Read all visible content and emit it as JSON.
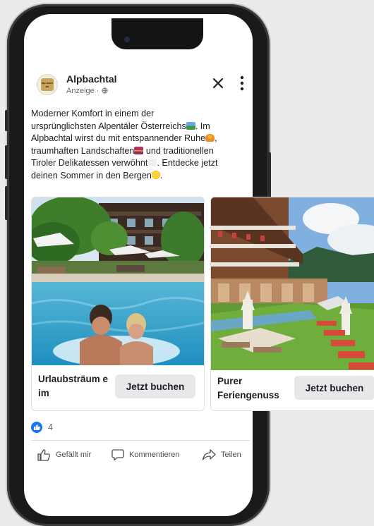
{
  "post": {
    "page_name": "Alpbachtal",
    "sponsored": "Anzeige · ",
    "logo_text": "alp bach tal",
    "text": {
      "l1": "Moderner Komfort in einem der",
      "l2": "ursprünglichsten Alpentäler Österreichs",
      "l2b": ". Im",
      "l3": "Alpbachtal wirst du mit entspannender Ruhe",
      "l3b": ",",
      "l4": "traumhaften Landschaften",
      "l4b": " und traditionellen",
      "l5": "Tiroler Delikatessen verwöhnt",
      "l5b": ". Entdecke jetzt",
      "l6": "deinen Sommer in den Bergen",
      "l6b": "."
    }
  },
  "carousel": [
    {
      "title": "Urlaubsträum e im",
      "cta": "Jetzt buchen"
    },
    {
      "title": "Purer Feriengenuss",
      "cta": "Jetzt buchen"
    }
  ],
  "reactions": {
    "count": "4"
  },
  "actions": {
    "like": "Gefällt mir",
    "comment": "Kommentieren",
    "share": "Teilen"
  },
  "icons": [
    "close-icon",
    "more-icon",
    "globe-icon",
    "like-icon",
    "comment-icon",
    "share-icon"
  ],
  "colors": {
    "facebook_blue": "#1877f2",
    "button_gray": "#e7e8ea",
    "text": "#1c1e21",
    "muted": "#65676b"
  }
}
